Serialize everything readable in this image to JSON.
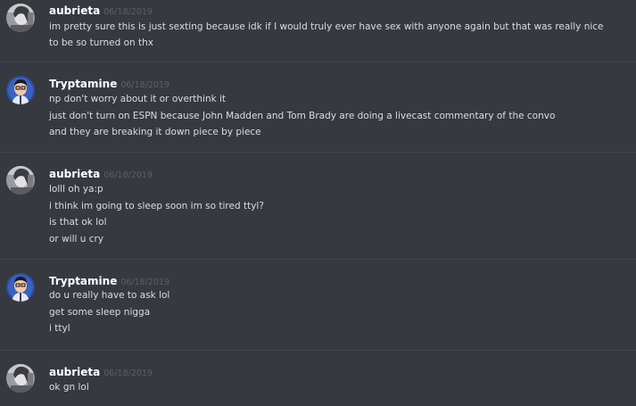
{
  "colors": {
    "background": "#36393f",
    "divider": "#41444a",
    "username": "#ffffff",
    "timestamp": "#5d6067",
    "message_text": "#dcddde"
  },
  "messages": [
    {
      "username": "aubrieta",
      "timestamp": "06/18/2019",
      "avatar_icon": "aubrieta-avatar-icon",
      "lines": [
        "im pretty sure this is just sexting because idk if I would truly ever have sex with anyone again but that was really nice to be so turned on thx"
      ]
    },
    {
      "username": "Tryptamine",
      "timestamp": "06/18/2019",
      "avatar_icon": "tryptamine-avatar-icon",
      "lines": [
        "np don't worry about it or overthink it",
        "just don't turn on ESPN because John Madden and Tom Brady are doing a livecast commentary of the convo",
        "and they are breaking it down piece by piece"
      ]
    },
    {
      "username": "aubrieta",
      "timestamp": "06/18/2019",
      "avatar_icon": "aubrieta-avatar-icon",
      "lines": [
        "lolll oh ya:p",
        "i think im going to sleep soon im so tired ttyl?",
        "is that ok lol",
        "or will u cry"
      ]
    },
    {
      "username": "Tryptamine",
      "timestamp": "06/18/2019",
      "avatar_icon": "tryptamine-avatar-icon",
      "lines": [
        "do u really have to ask lol",
        "get some sleep nigga",
        "i ttyl"
      ]
    },
    {
      "username": "aubrieta",
      "timestamp": "06/18/2019",
      "avatar_icon": "aubrieta-avatar-icon",
      "lines": [
        "ok gn lol"
      ]
    }
  ]
}
